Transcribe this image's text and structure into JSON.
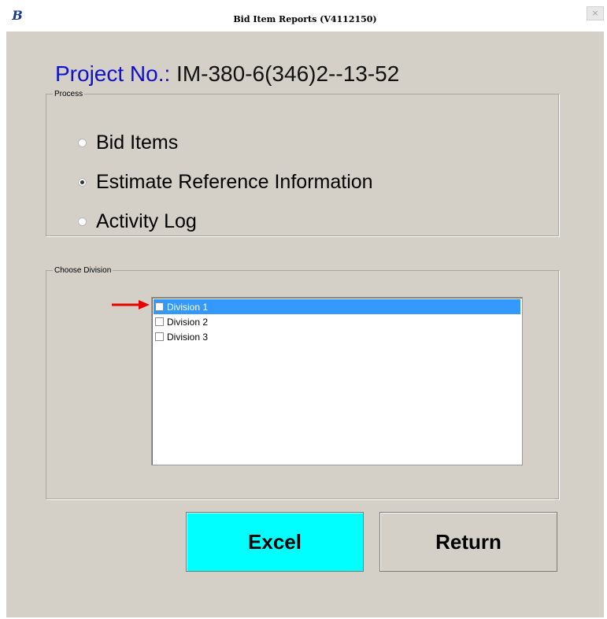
{
  "window": {
    "title": "Bid Item Reports (V4112150)",
    "close_glyph": "×",
    "app_icon": "B"
  },
  "project": {
    "label": "Project No.:",
    "value": " IM-380-6(346)2--13-52"
  },
  "process": {
    "legend": "Process",
    "options": [
      {
        "label": "Bid Items",
        "checked": false
      },
      {
        "label": "Estimate Reference Information",
        "checked": true
      },
      {
        "label": "Activity Log",
        "checked": false
      }
    ]
  },
  "division": {
    "legend": "Choose Division",
    "items": [
      {
        "label": "Division 1",
        "checked": false,
        "selected": true
      },
      {
        "label": "Division 2",
        "checked": false,
        "selected": false
      },
      {
        "label": "Division 3",
        "checked": false,
        "selected": false
      }
    ]
  },
  "buttons": {
    "excel": "Excel",
    "return": "Return"
  },
  "colors": {
    "window_bg": "#d4d0c8",
    "project_label": "#1010d0",
    "excel_button": "#00ffff",
    "selection": "#3399ff",
    "arrow": "#e60000"
  }
}
